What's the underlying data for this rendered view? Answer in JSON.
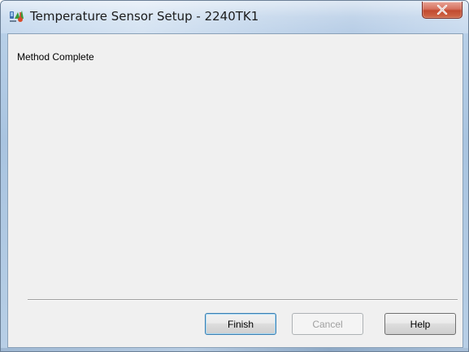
{
  "window": {
    "title": "Temperature Sensor Setup - 2240TK1",
    "icon": "sensor-setup-app-icon",
    "close_icon": "close-icon"
  },
  "content": {
    "status_text": "Method Complete"
  },
  "buttons": {
    "finish": {
      "label": "Finish",
      "enabled": true,
      "default": true
    },
    "cancel": {
      "label": "Cancel",
      "enabled": false
    },
    "help": {
      "label": "Help",
      "enabled": true
    }
  },
  "colors": {
    "close_button": "#c24a30",
    "client_background": "#f0f0f0",
    "disabled_text": "#a0a0a0"
  }
}
